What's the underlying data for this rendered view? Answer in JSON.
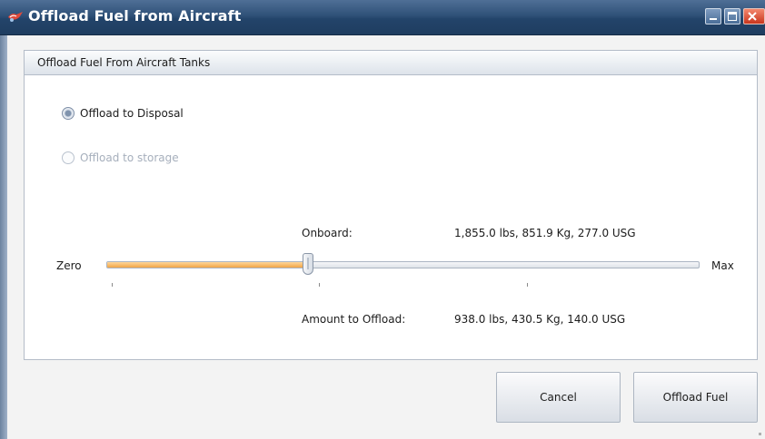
{
  "window": {
    "title": "Offload Fuel from Aircraft"
  },
  "group": {
    "header": "Offload Fuel From Aircraft Tanks"
  },
  "options": {
    "disposal": {
      "label": "Offload to Disposal",
      "checked": true,
      "enabled": true
    },
    "storage": {
      "label": "Offload to storage",
      "checked": false,
      "enabled": false
    }
  },
  "slider": {
    "min_label": "Zero",
    "max_label": "Max",
    "value_fraction": 0.34
  },
  "fuel": {
    "onboard_label": "Onboard:",
    "onboard_value": "1,855.0 lbs, 851.9 Kg, 277.0 USG",
    "offload_label": "Amount to Offload:",
    "offload_value": "938.0 lbs, 430.5 Kg, 140.0 USG"
  },
  "buttons": {
    "cancel": "Cancel",
    "offload": "Offload Fuel"
  },
  "colors": {
    "titlebar": "#2f5178",
    "slider_fill": "#f0a546",
    "disabled_text": "#a6afbc"
  }
}
